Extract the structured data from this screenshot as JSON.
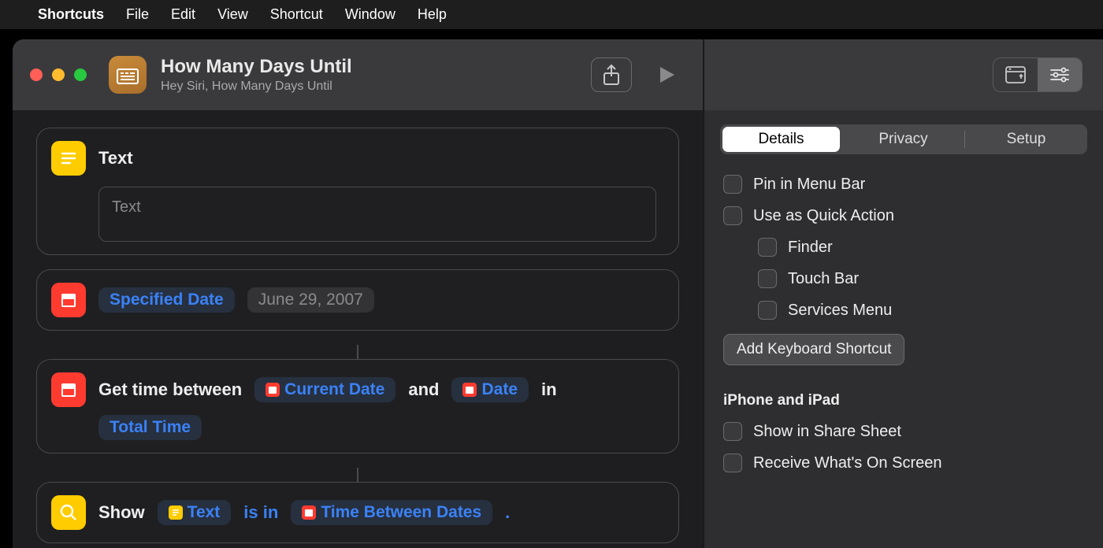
{
  "menubar": {
    "app": "Shortcuts",
    "items": [
      "File",
      "Edit",
      "View",
      "Shortcut",
      "Window",
      "Help"
    ]
  },
  "titlebar": {
    "title": "How Many Days Until",
    "subtitle": "Hey Siri, How Many Days Until"
  },
  "actions": {
    "text": {
      "label": "Text",
      "placeholder": "Text"
    },
    "specifiedDate": {
      "label": "Specified Date",
      "value": "June 29, 2007"
    },
    "timeBetween": {
      "pre": "Get time between",
      "p1": "Current Date",
      "mid": "and",
      "p2": "Date",
      "post": "in",
      "unit": "Total Time"
    },
    "show": {
      "pre": "Show",
      "p1": "Text",
      "mid": "is in",
      "p2": "Time Between Dates",
      "post": "."
    }
  },
  "side": {
    "tabs": {
      "details": "Details",
      "privacy": "Privacy",
      "setup": "Setup"
    },
    "pinMenuBar": "Pin in Menu Bar",
    "quickAction": "Use as Quick Action",
    "finder": "Finder",
    "touchBar": "Touch Bar",
    "servicesMenu": "Services Menu",
    "addKeyboard": "Add Keyboard Shortcut",
    "sectionMobile": "iPhone and iPad",
    "shareSheet": "Show in Share Sheet",
    "receiveScreen": "Receive What's On Screen"
  }
}
